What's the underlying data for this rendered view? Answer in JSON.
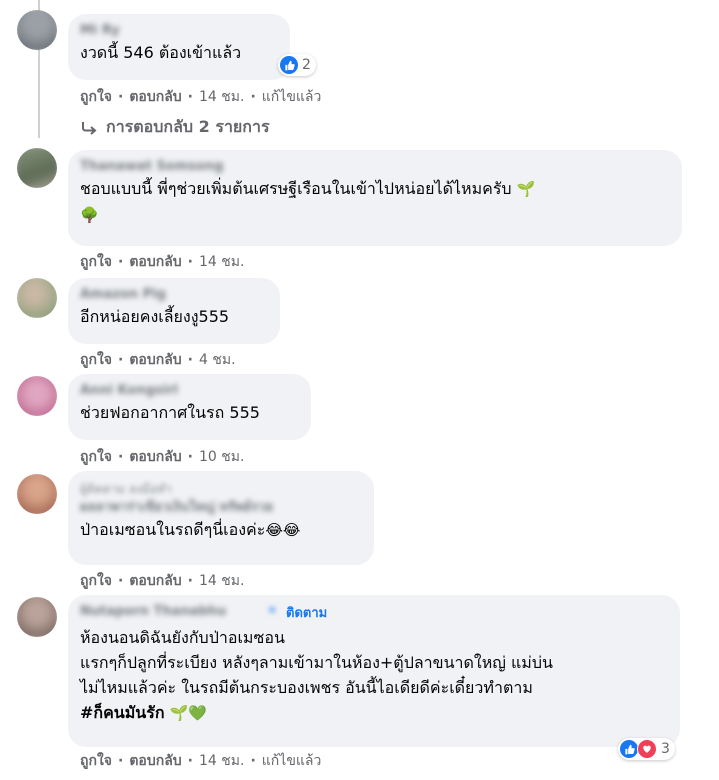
{
  "comments": [
    {
      "text": "งวดนี้ 546 ต้องเข้าแล้ว",
      "reactions": "2",
      "actions": {
        "like": "ถูกใจ",
        "reply": "ตอบกลับ",
        "time": "14 ชม.",
        "edited": "แก้ไขแล้ว"
      },
      "view_replies": "การตอบกลับ 2 รายการ"
    },
    {
      "text_line1": "ชอบแบบนี้ พี่ๆช่วยเพิ่มต้นเศรษฐีเรือนในเข้าไปหน่อยได้ไหมครับ",
      "emoji1": "🌱",
      "emoji2": "🌳",
      "actions": {
        "like": "ถูกใจ",
        "reply": "ตอบกลับ",
        "time": "14 ชม."
      }
    },
    {
      "text": "อีกหน่อยคงเลี้ยงงู555",
      "actions": {
        "like": "ถูกใจ",
        "reply": "ตอบกลับ",
        "time": "4 ชม."
      }
    },
    {
      "text": "ช่วยฟอกอากาศในรถ 555",
      "actions": {
        "like": "ถูกใจ",
        "reply": "ตอบกลับ",
        "time": "10 ชม."
      }
    },
    {
      "text": "ป่าอเมซอนในรถดีๆนี่เองค่ะ",
      "emoji": "😂😂",
      "actions": {
        "like": "ถูกใจ",
        "reply": "ตอบกลับ",
        "time": "14 ชม."
      }
    },
    {
      "follow_label": "ติดตาม",
      "line1": "ห้องนอนดิฉันยังกับป่าอเมซอน",
      "line2": "แรกๆก็ปลูกที่ระเบียง หลังๆลามเข้ามาในห้อง+ตู้ปลาขนาดใหญ่ แม่บ่น",
      "line3": "ไม่ไหมแล้วค่ะ ในรถมีต้นกระบองเพชร อันนี้ไอเดียดีค่ะเดี๋ยวทำตาม",
      "hashtag": "#ก็คนมันรัก",
      "emoji": "🌱💚",
      "reactions": "3",
      "actions": {
        "like": "ถูกใจ",
        "reply": "ตอบกลับ",
        "time": "14 ชม.",
        "edited": "แก้ไขแล้ว"
      }
    }
  ],
  "colors": {
    "bubble": "#f0f2f5",
    "meta": "#65676b",
    "like": "#1877f2",
    "love": "#f33e58"
  }
}
